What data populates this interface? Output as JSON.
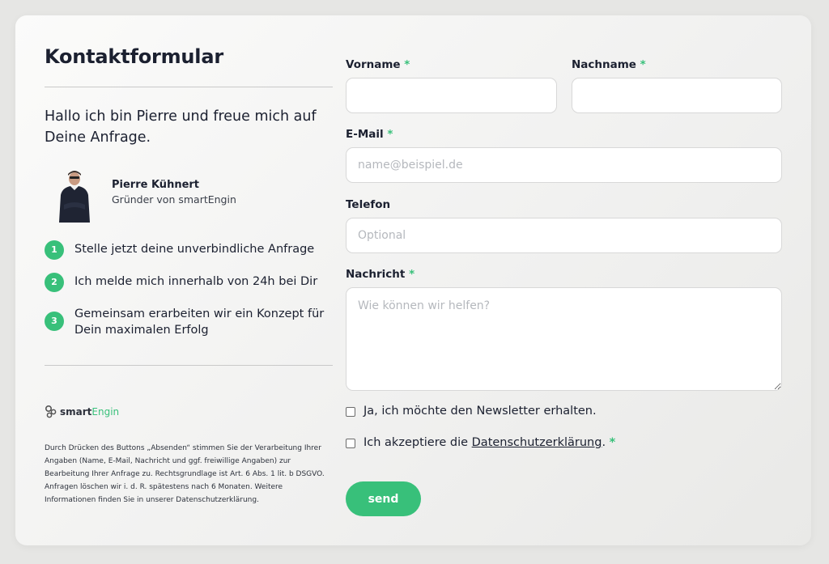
{
  "left": {
    "title": "Kontaktformular",
    "intro": "Hallo ich bin Pierre und freue mich auf Deine Anfrage.",
    "person": {
      "name": "Pierre Kühnert",
      "role": "Gründer von smartEngin"
    },
    "steps": [
      {
        "num": "1",
        "text": "Stelle jetzt deine unverbindliche Anfrage"
      },
      {
        "num": "2",
        "text": "Ich melde mich innerhalb von 24h bei Dir"
      },
      {
        "num": "3",
        "text": "Gemeinsam erarbeiten wir ein Konzept für Dein maximalen Erfolg"
      }
    ],
    "logo": {
      "part1": "smart",
      "part2": "Engin"
    },
    "disclaimer": "Durch Drücken des Buttons „Absenden“ stimmen Sie der Verarbeitung Ihrer Angaben (Name, E-Mail, Nachricht und ggf. freiwillige Angaben) zur Bearbeitung Ihrer Anfrage zu. Rechtsgrundlage ist Art. 6 Abs. 1 lit. b DSGVO. Anfragen löschen wir i. d. R. spätestens nach 6 Monaten. Weitere Informationen finden Sie in unserer Datenschutzerklärung."
  },
  "form": {
    "required_mark": "*",
    "firstname": {
      "label": "Vorname",
      "value": "",
      "placeholder": ""
    },
    "lastname": {
      "label": "Nachname",
      "value": "",
      "placeholder": ""
    },
    "email": {
      "label": "E-Mail",
      "value": "",
      "placeholder": "name@beispiel.de"
    },
    "phone": {
      "label": "Telefon",
      "value": "",
      "placeholder": "Optional"
    },
    "message": {
      "label": "Nachricht",
      "value": "",
      "placeholder": "Wie können wir helfen?"
    },
    "newsletter": {
      "label": "Ja, ich möchte den Newsletter erhalten."
    },
    "privacy": {
      "label_prefix": "Ich akzeptiere die ",
      "link": "Datenschutzerklärung",
      "label_suffix": "."
    },
    "submit_label": "send"
  },
  "colors": {
    "accent": "#38c07a",
    "text": "#1b2030",
    "background": "#e6e6e4"
  },
  "icons": {
    "logo": "gears-icon"
  }
}
